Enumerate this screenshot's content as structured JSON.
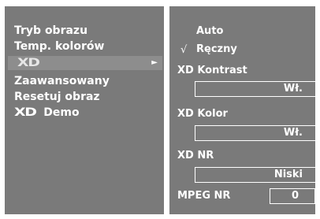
{
  "menu": {
    "items": [
      {
        "label": "Tryb obrazu"
      },
      {
        "label": "Temp. kolorów"
      },
      {
        "label": "",
        "logo": "XD",
        "selected": true
      },
      {
        "label": "Zaawansowany"
      },
      {
        "label": "Resetuj obraz"
      },
      {
        "label": "Demo",
        "logo": "XD"
      }
    ],
    "submenu_arrow": "►"
  },
  "xd_panel": {
    "options": [
      {
        "label": "Auto",
        "checked": false
      },
      {
        "label": "Ręczny",
        "checked": true
      }
    ],
    "check_mark": "√",
    "contrast": {
      "label": "XD Kontrast",
      "value": "Wł."
    },
    "color": {
      "label": "XD Kolor",
      "value": "Wł."
    },
    "nr": {
      "label": "XD NR",
      "value": "Niski"
    },
    "mpeg_nr": {
      "label": "MPEG NR",
      "value": "0"
    }
  },
  "logo_text": "XD"
}
